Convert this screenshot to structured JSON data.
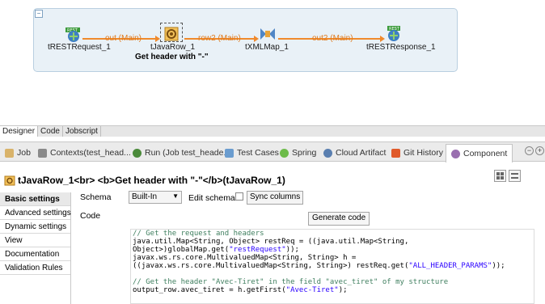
{
  "designer": {
    "components": [
      {
        "name": "tRESTRequest_1"
      },
      {
        "name": "tJavaRow_1",
        "sublabel": "Get header with \"-\""
      },
      {
        "name": "tXMLMap_1"
      },
      {
        "name": "tRESTResponse_1"
      }
    ],
    "links": [
      {
        "label": "out (Main)"
      },
      {
        "label": "row2 (Main)"
      },
      {
        "label": "out2 (Main)"
      }
    ],
    "collapse_glyph": "−",
    "link_color": "#f08a2c"
  },
  "designer_tabs": [
    "Designer",
    "Code",
    "Jobscript"
  ],
  "view_tabs": [
    {
      "label": "Job",
      "icon": "job-icon"
    },
    {
      "label": "Contexts(test_head...",
      "icon": "contexts-icon"
    },
    {
      "label": "Run (Job test_heade...",
      "icon": "run-icon"
    },
    {
      "label": "Test Cases",
      "icon": "test-cases-icon"
    },
    {
      "label": "Spring",
      "icon": "spring-icon"
    },
    {
      "label": "Cloud Artifact",
      "icon": "cloud-artifact-icon"
    },
    {
      "label": "Git History",
      "icon": "git-history-icon"
    },
    {
      "label": "Component",
      "icon": "component-icon",
      "active": true
    }
  ],
  "component_title": "tJavaRow_1<br> <b>Get header with \"-\"</b>(tJavaRow_1)",
  "settings_menu": [
    "Basic settings",
    "Advanced settings",
    "Dynamic settings",
    "View",
    "Documentation",
    "Validation Rules"
  ],
  "basic_settings": {
    "schema_label": "Schema",
    "schema_value": "Built-In",
    "edit_schema_label": "Edit schema",
    "sync_columns_label": "Sync columns",
    "code_label": "Code",
    "generate_code_label": "Generate code"
  },
  "code_lines": [
    "// Get the request and headers",
    "java.util.Map<String, Object> restReq = ((java.util.Map<String,",
    "Object>)globalMap.get(\"restRequest\"));",
    "javax.ws.rs.core.MultivaluedMap<String, String> h =",
    "((javax.ws.rs.core.MultivaluedMap<String, String>) restReq.get(\"ALL_HEADER_PARAMS\"));",
    "",
    "// Get the header \"Avec-Tiret\" in the field \"avec_tiret\" of my structure",
    "output_row.avec_tiret = h.getFirst(\"Avec-Tiret\");"
  ]
}
